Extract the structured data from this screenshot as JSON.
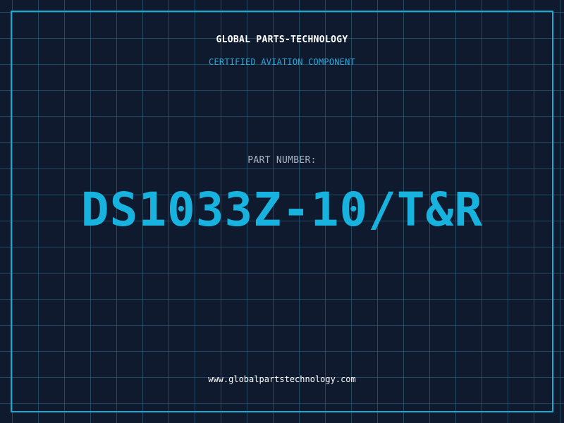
{
  "header": {
    "company": "GLOBAL PARTS-TECHNOLOGY",
    "subtitle": "CERTIFIED AVIATION COMPONENT"
  },
  "main": {
    "label": "PART NUMBER:",
    "part_number": "DS1033Z-10/T&R"
  },
  "footer": {
    "url": "www.globalpartstechnology.com"
  },
  "colors": {
    "background": "#0f1a2e",
    "grid": "#2f708a",
    "accent": "#17b3de",
    "border": "#1aa8d4",
    "label": "#a9b4c2",
    "text": "#ffffff"
  }
}
